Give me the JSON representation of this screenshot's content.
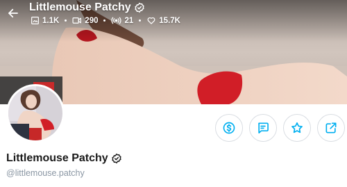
{
  "header": {
    "title": "Littlemouse Patchy",
    "stats": {
      "photos": "1.1K",
      "videos": "290",
      "streams": "21",
      "likes": "15.7K"
    }
  },
  "profile": {
    "name": "Littlemouse Patchy",
    "handle": "@littlemouse.patchy"
  },
  "icons": {
    "back": "arrow-left-icon",
    "verified": "verified-check-icon",
    "photos": "image-icon",
    "videos": "video-icon",
    "streams": "broadcast-icon",
    "likes": "heart-icon",
    "tip": "dollar-icon",
    "message": "message-icon",
    "favorite": "star-icon",
    "share": "share-icon"
  },
  "colors": {
    "accent": "#00aff0",
    "text": "#1a1a1a",
    "muted": "#8a96a3",
    "border": "#d9dde2"
  }
}
